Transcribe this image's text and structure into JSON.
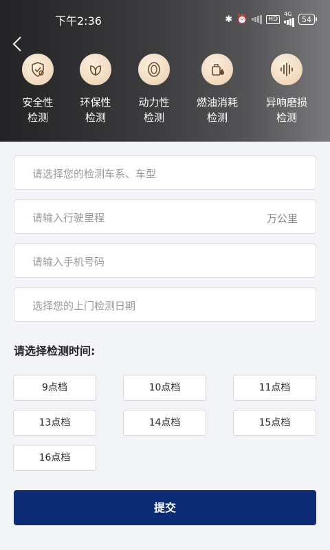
{
  "status_bar": {
    "time": "下午2:36",
    "hd": "HD",
    "network": "4G",
    "battery": "54"
  },
  "features": [
    {
      "label": "安全性\n检测",
      "icon": "shield-check-icon"
    },
    {
      "label": "环保性\n检测",
      "icon": "leaf-icon"
    },
    {
      "label": "动力性\n检测",
      "icon": "tire-icon"
    },
    {
      "label": "燃油消耗\n检测",
      "icon": "fuel-drop-icon"
    },
    {
      "label": "异响磨损\n检测",
      "icon": "sound-wave-icon"
    }
  ],
  "form": {
    "car_model_placeholder": "请选择您的检测车系、车型",
    "mileage_placeholder": "请输入行驶里程",
    "mileage_unit": "万公里",
    "phone_placeholder": "请输入手机号码",
    "date_placeholder": "选择您的上门检测日期"
  },
  "time_section": {
    "title": "请选择检测时间:",
    "slots": [
      "9点档",
      "10点档",
      "11点档",
      "13点档",
      "14点档",
      "15点档",
      "16点档"
    ]
  },
  "submit_label": "提交",
  "colors": {
    "primary": "#0b2b75",
    "icon_bg": "#f0d9bd",
    "icon_stroke": "#6b4a2e"
  }
}
